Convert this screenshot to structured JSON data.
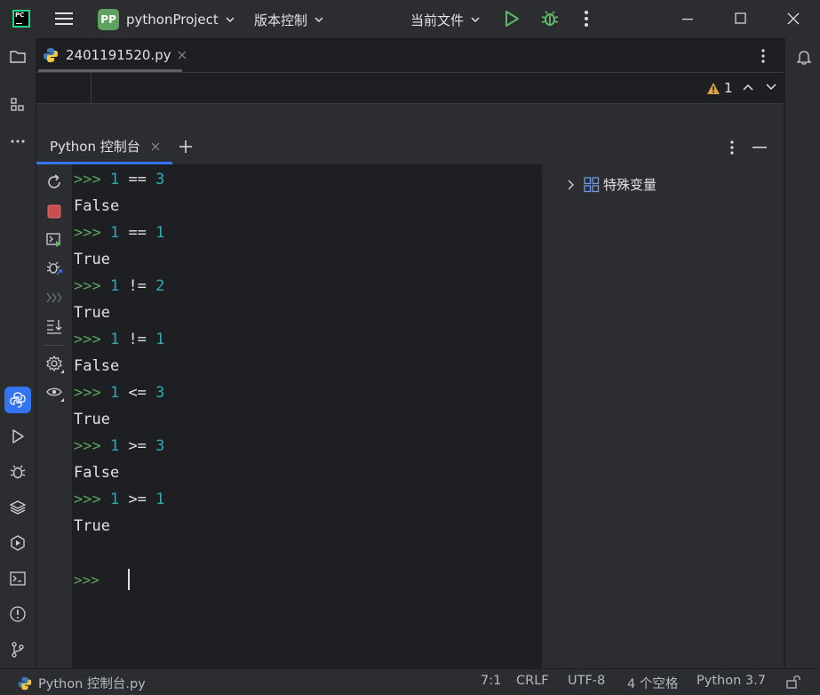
{
  "titlebar": {
    "logo_text": "PC",
    "project_badge": "PP",
    "project_name": "pythonProject",
    "vcs_label": "版本控制",
    "run_config": "当前文件"
  },
  "editor": {
    "tab_label": "2401191520.py",
    "warning_count": "1"
  },
  "tool_window": {
    "tab_label": "Python 控制台"
  },
  "console": {
    "lines": [
      {
        "prompt": ">>> ",
        "a": "1",
        "op": " == ",
        "b": "3"
      },
      {
        "output": "False"
      },
      {
        "prompt": ">>> ",
        "a": "1",
        "op": " == ",
        "b": "1"
      },
      {
        "output": "True"
      },
      {
        "prompt": ">>> ",
        "a": "1",
        "op": " != ",
        "b": "2"
      },
      {
        "output": "True"
      },
      {
        "prompt": ">>> ",
        "a": "1",
        "op": " != ",
        "b": "1"
      },
      {
        "output": "False"
      },
      {
        "prompt": ">>> ",
        "a": "1",
        "op": " <= ",
        "b": "3"
      },
      {
        "output": "True"
      },
      {
        "prompt": ">>> ",
        "a": "1",
        "op": " >= ",
        "b": "3"
      },
      {
        "output": "False"
      },
      {
        "prompt": ">>> ",
        "a": "1",
        "op": " >= ",
        "b": "1"
      },
      {
        "output": "True"
      }
    ],
    "input_prompt": ">>>"
  },
  "variables": {
    "special_label": "特殊变量"
  },
  "statusbar": {
    "console_name": "Python 控制台.py",
    "position": "7:1",
    "line_sep": "CRLF",
    "encoding": "UTF-8",
    "indent": "4 个空格",
    "interpreter": "Python 3.7"
  },
  "colors": {
    "prompt": "#5ea35e",
    "number": "#2aacb8",
    "accent": "#3574f0"
  }
}
